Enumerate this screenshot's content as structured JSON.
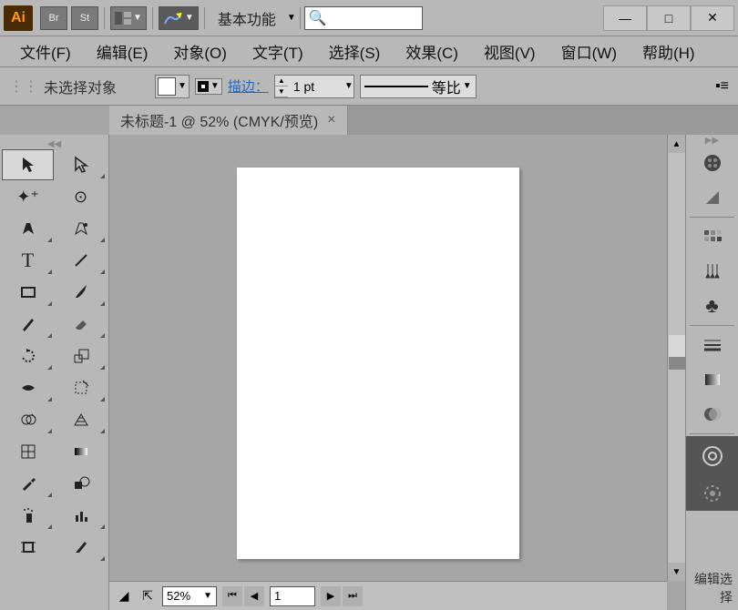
{
  "titlebar": {
    "logo": "Ai",
    "bridge": "Br",
    "stock": "St",
    "workspace": "基本功能",
    "search_placeholder": ""
  },
  "menu": {
    "file": "文件(F)",
    "edit": "编辑(E)",
    "object": "对象(O)",
    "type": "文字(T)",
    "select": "选择(S)",
    "effect": "效果(C)",
    "view": "视图(V)",
    "window": "窗口(W)",
    "help": "帮助(H)"
  },
  "controlbar": {
    "no_selection": "未选择对象",
    "stroke_label": "描边：",
    "stroke_width": "1 pt",
    "profile": "等比"
  },
  "document": {
    "tab_title": "未标题-1 @ 52% (CMYK/预览)"
  },
  "status": {
    "zoom": "52%",
    "page": "1"
  },
  "rightdock": {
    "edit_select": "编辑选择"
  }
}
